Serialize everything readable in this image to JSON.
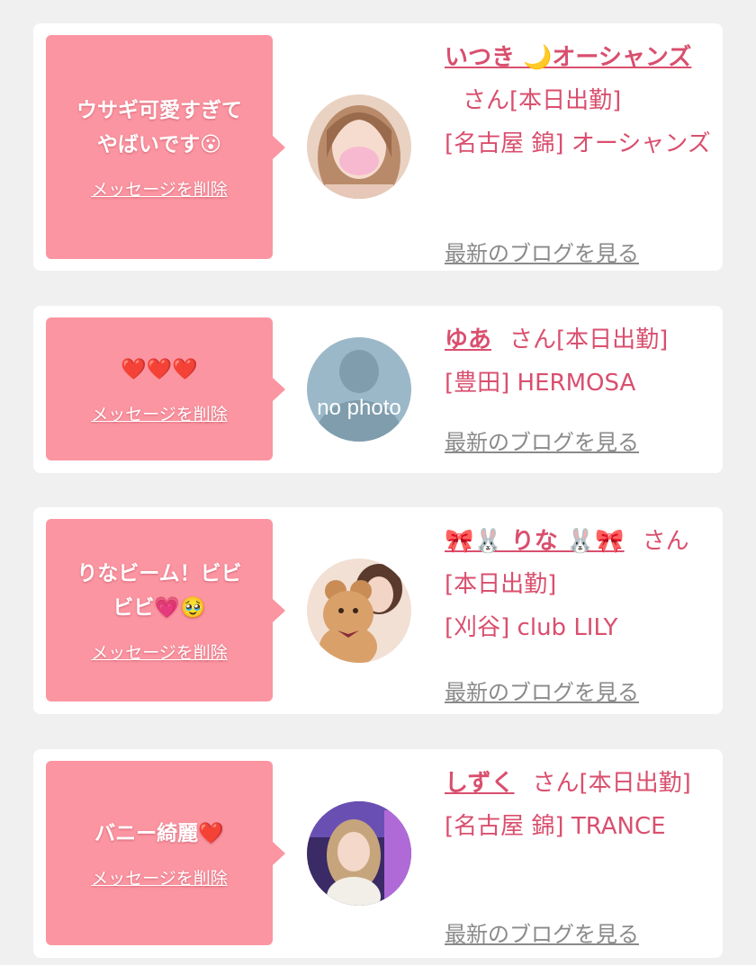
{
  "delete_label": "メッセージを削除",
  "blog_label": "最新のブログを見る",
  "san_label": "さん[本日出勤]",
  "no_photo_text": "no photo",
  "colors": {
    "background": "#f0f0f0",
    "bubble": "#fb95a1",
    "accent": "#d94f6e",
    "link_gray": "#8a8a8a"
  },
  "cards": [
    {
      "message_line1": "ウサギ可愛すぎて",
      "message_line2": "やばいです",
      "message_emoji": "😮",
      "name": "いつき 🌙オーシャンズ",
      "shop": "[名古屋 錦] オーシャンズ",
      "avatar": "woman-photo"
    },
    {
      "message_line1": "❤️❤️❤️",
      "name": "ゆあ",
      "shop": "[豊田] HERMOSA",
      "avatar": "no-photo"
    },
    {
      "message_line1": "りなビーム！ビビ",
      "message_line2": "ビビ",
      "message_emoji": "💗🥹",
      "name": "🎀🐰 りな 🐰🎀",
      "shop": "[刈谷] club LILY",
      "avatar": "woman-with-teddy-bear"
    },
    {
      "message_line1": "バニー綺麗❤️",
      "name": "しずく",
      "shop": "[名古屋 錦] TRANCE",
      "avatar": "woman-photo-neon"
    }
  ]
}
